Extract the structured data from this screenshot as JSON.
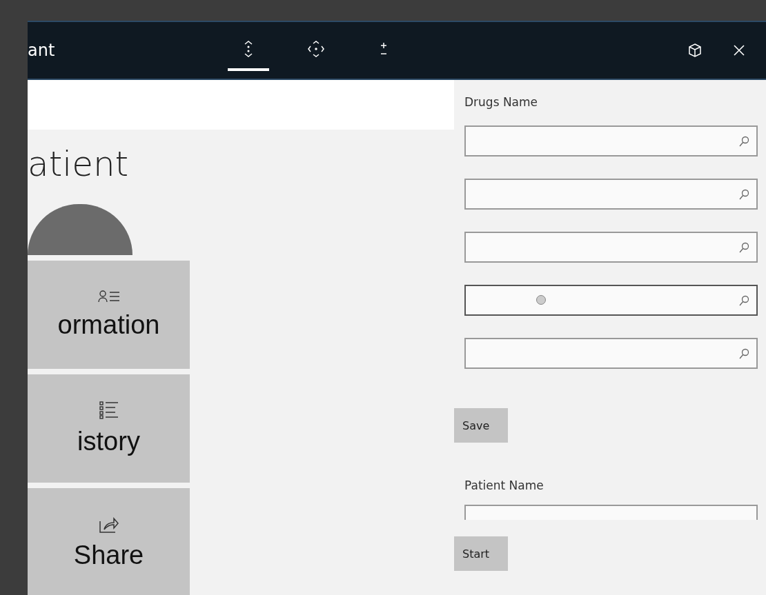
{
  "window": {
    "title": "ant"
  },
  "toolbar": [
    {
      "kind": "adjust",
      "selected": true
    },
    {
      "kind": "move",
      "selected": false
    },
    {
      "kind": "scale",
      "selected": false
    }
  ],
  "left": {
    "heading": "atient",
    "cards": [
      {
        "kind": "info",
        "label": "ormation"
      },
      {
        "kind": "history",
        "label": "istory"
      },
      {
        "kind": "share",
        "label": "Share"
      }
    ]
  },
  "drugs": {
    "label": "Drugs Name",
    "fields": [
      {
        "hovered": false
      },
      {
        "hovered": false
      },
      {
        "hovered": false
      },
      {
        "hovered": true
      },
      {
        "hovered": false
      }
    ]
  },
  "save_button": "Save",
  "patient": {
    "label": "Patient Name"
  },
  "start_button": "Start"
}
